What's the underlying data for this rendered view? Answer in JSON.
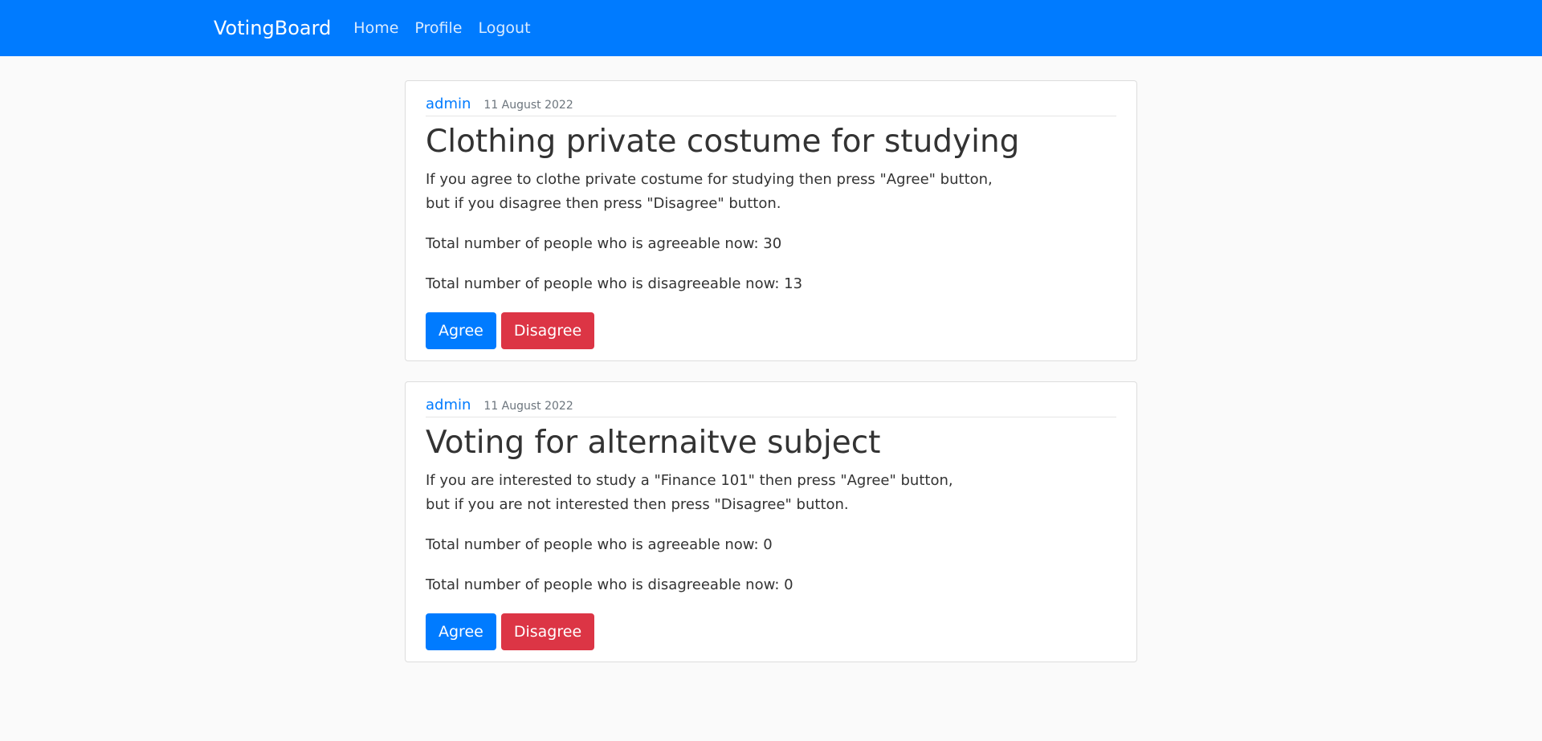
{
  "navbar": {
    "brand": "VotingBoard",
    "links": [
      "Home",
      "Profile",
      "Logout"
    ],
    "color": "#007bff"
  },
  "posts": [
    {
      "author": "admin",
      "date": "11 August 2022",
      "title": "Clothing private costume for studying",
      "desc_line1": "If you agree to clothe private costume for studying then press \"Agree\" button,",
      "desc_line2": "but if you disagree then press \"Disagree\" button.",
      "agree_text": "Total number of people who is agreeable now: 30",
      "disagree_text": "Total number of people who is disagreeable now: 13",
      "agree_label": "Agree",
      "disagree_label": "Disagree"
    },
    {
      "author": "admin",
      "date": "11 August 2022",
      "title": "Voting for alternaitve subject",
      "desc_line1": "If you are interested to study a \"Finance 101\" then press \"Agree\" button,",
      "desc_line2": "but if you are not interested then press \"Disagree\" button.",
      "agree_text": "Total number of people who is agreeable now: 0",
      "disagree_text": "Total number of people who is disagreeable now: 0",
      "agree_label": "Agree",
      "disagree_label": "Disagree"
    }
  ],
  "colors": {
    "agree_button": "#007bff",
    "disagree_button": "#dc3545",
    "page_background": "#fafafa"
  }
}
